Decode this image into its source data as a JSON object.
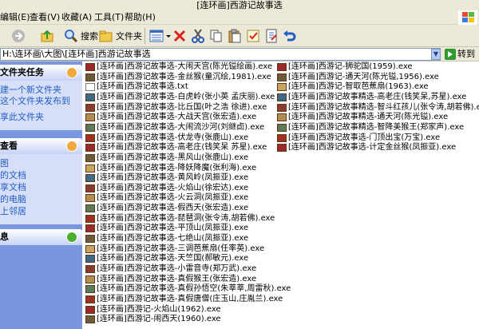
{
  "window": {
    "title": "[连环画]西游记故事选"
  },
  "menu": [
    "编辑(E)",
    "查看(V)",
    "收藏(A)",
    "工具(T)",
    "帮助(H)"
  ],
  "toolbar": {
    "search_label": "搜索",
    "folders_label": "文件夹"
  },
  "address": {
    "value": "H:\\连环画\\大图\\[连环画]西游记故事选",
    "go_label": "转到"
  },
  "taskpane": {
    "file_tasks": {
      "title": "文件夹任务",
      "items": [
        "建一个新文件夹",
        "这个文件夹发布到",
        "享此文件夹"
      ]
    },
    "other_places": {
      "title": "查看",
      "items": [
        "图",
        "的文档",
        "享文档",
        "的电脑",
        "上邻居"
      ]
    },
    "details": {
      "title": "息"
    }
  },
  "files_col1": [
    "[连环画]西游记故事选-大闹天宫(陈光镒绘画).exe",
    "[连环画]西游记故事选-金丝猴(童沉绘,1981).exe",
    "[连环画]西游记故事选.txt",
    "[连环画]西游记故事选-白虎岭(张小英 孟庆丽).exe",
    "[连环画]西游记故事选-比丘国(叶之浩 徐进).exe",
    "[连环画]西游记故事选-大战天宫(张宏造).exe",
    "[连环画]西游记故事选-大闹流沙河(刘继卣).exe",
    "[连环画]西游记故事选-伏龙寺(张鹿山).exe",
    "[连环画]西游记故事选-高老庄(钱笑呆 苏星).exe",
    "[连环画]西游记故事选-黑风山(张鹿山).exe",
    "[连环画]西游记故事选-降妖降魔(张利海).exe",
    "[连环画]西游记故事选-黄风岭(凤振亚).exe",
    "[连环画]西游记故事选-火焰山(徐宏达).exe",
    "[连环画]西游记故事选-火云洞(凤振亚).exe",
    "[连环画]西游记故事选-假西天(张宏造).exe",
    "[连环画]西游记故事选-琵琶洞(张令涛,胡若佛).exe",
    "[连环画]西游记故事选-平顶山(凤振亚).exe",
    "[连环画]西游记故事选-七绝山(凤振亚).exe",
    "[连环画]西游记故事选-三调芭蕉扇(任率英).exe",
    "[连环画]西游记故事选-天竺国(郝敏元).exe",
    "[连环画]西游记故事选-小雷音寺(郑万武).exe",
    "[连环画]西游记故事选-真假猴王(张宏造).exe",
    "[连环画]西游记故事选-真假孙悟空(朱莘莘,周雷秋).exe",
    "[连环画]西游记故事选-真假唐僧(庄玉山,庄胤兰).exe",
    "[连环画]西游记-火焰山(1962).exe",
    "[连环画]西游记-闹西天(1960).exe"
  ],
  "files_col2": [
    "[连环画]西游记-狮驼国(1959).exe",
    "[连环画]西游记-通天河(陈光镒,1956).exe",
    "[连环画]西游记-智取芭蕉扇(1963).exe",
    "[连环画]西游记故事精选-高老庄(钱笑呆,苏星).exe",
    "[连环画]西游记故事精选-智斗红孩儿(张令涛,胡若佛).exe",
    "[连环画]西游记故事精选-通天河(陈光镒).exe",
    "[连环画]西游记故事精选-智降美猴王(郑家声).exe",
    "[连环画]西游记故事选-门顶出宝(万宝).exe",
    "[连环画]西游记故事选-计定金丝猴(凤振亚).exe"
  ],
  "colors": {
    "taskpane_bg": "#7a96df",
    "panel_body": "#d6dff7",
    "link": "#215dc6",
    "chrome": "#ece9d8"
  }
}
